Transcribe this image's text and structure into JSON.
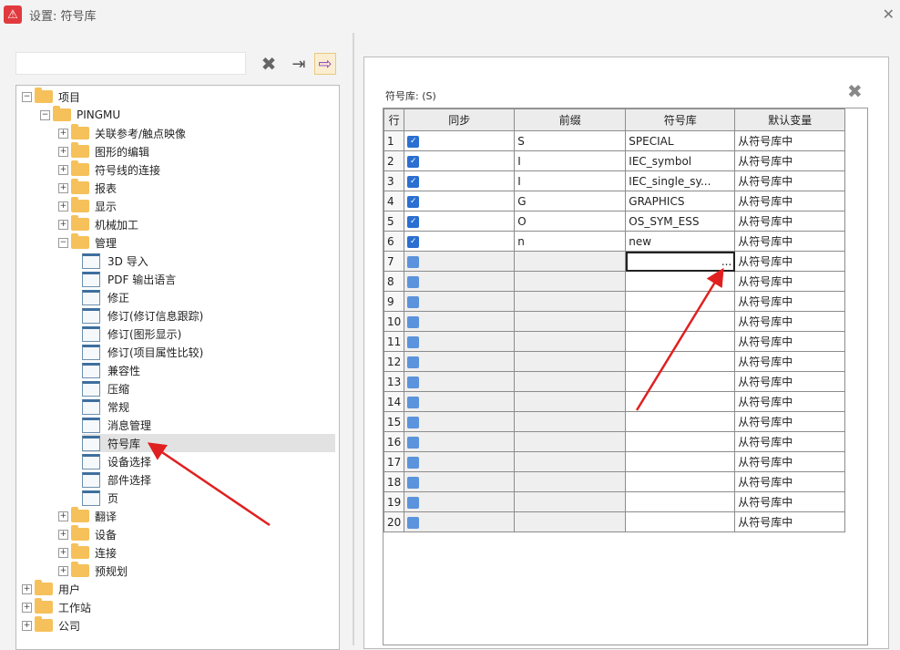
{
  "window": {
    "title": "设置: 符号库",
    "app_icon": "warning-triangle-icon"
  },
  "toolbar": {
    "clear_icon": "close-x-icon",
    "import_icon": "import-icon",
    "export_icon": "export-icon"
  },
  "tree": [
    {
      "label": "项目",
      "level": 0,
      "type": "folder",
      "state": "expanded"
    },
    {
      "label": "PINGMU",
      "level": 1,
      "type": "folder",
      "state": "expanded"
    },
    {
      "label": "关联参考/触点映像",
      "level": 2,
      "type": "folder",
      "state": "collapsed"
    },
    {
      "label": "图形的编辑",
      "level": 2,
      "type": "folder",
      "state": "collapsed"
    },
    {
      "label": "符号线的连接",
      "level": 2,
      "type": "folder",
      "state": "collapsed"
    },
    {
      "label": "报表",
      "level": 2,
      "type": "folder",
      "state": "collapsed"
    },
    {
      "label": "显示",
      "level": 2,
      "type": "folder",
      "state": "collapsed"
    },
    {
      "label": "机械加工",
      "level": 2,
      "type": "folder",
      "state": "collapsed"
    },
    {
      "label": "管理",
      "level": 2,
      "type": "folder",
      "state": "expanded"
    },
    {
      "label": "3D 导入",
      "level": 3,
      "type": "page"
    },
    {
      "label": "PDF 输出语言",
      "level": 3,
      "type": "page"
    },
    {
      "label": "修正",
      "level": 3,
      "type": "page"
    },
    {
      "label": "修订(修订信息跟踪)",
      "level": 3,
      "type": "page"
    },
    {
      "label": "修订(图形显示)",
      "level": 3,
      "type": "page"
    },
    {
      "label": "修订(项目属性比较)",
      "level": 3,
      "type": "page"
    },
    {
      "label": "兼容性",
      "level": 3,
      "type": "page"
    },
    {
      "label": "压缩",
      "level": 3,
      "type": "page"
    },
    {
      "label": "常规",
      "level": 3,
      "type": "page"
    },
    {
      "label": "消息管理",
      "level": 3,
      "type": "page"
    },
    {
      "label": "符号库",
      "level": 3,
      "type": "page",
      "selected": true
    },
    {
      "label": "设备选择",
      "level": 3,
      "type": "page"
    },
    {
      "label": "部件选择",
      "level": 3,
      "type": "page"
    },
    {
      "label": "页",
      "level": 3,
      "type": "page"
    },
    {
      "label": "翻译",
      "level": 2,
      "type": "folder",
      "state": "collapsed"
    },
    {
      "label": "设备",
      "level": 2,
      "type": "folder",
      "state": "collapsed"
    },
    {
      "label": "连接",
      "level": 2,
      "type": "folder",
      "state": "collapsed"
    },
    {
      "label": "预规划",
      "level": 2,
      "type": "folder",
      "state": "collapsed"
    },
    {
      "label": "用户",
      "level": 0,
      "type": "folder",
      "state": "collapsed"
    },
    {
      "label": "工作站",
      "level": 0,
      "type": "folder",
      "state": "collapsed"
    },
    {
      "label": "公司",
      "level": 0,
      "type": "folder",
      "state": "collapsed"
    }
  ],
  "panel": {
    "label": "符号库: (S)",
    "close_icon": "close-x-icon"
  },
  "table": {
    "headers": [
      "行",
      "同步",
      "前缀",
      "符号库",
      "默认变量"
    ],
    "rows": [
      {
        "n": "1",
        "sync": true,
        "prefix": "S",
        "lib": "SPECIAL",
        "def": "从符号库中"
      },
      {
        "n": "2",
        "sync": true,
        "prefix": "I",
        "lib": "IEC_symbol",
        "def": "从符号库中"
      },
      {
        "n": "3",
        "sync": true,
        "prefix": "I",
        "lib": "IEC_single_sy...",
        "def": "从符号库中"
      },
      {
        "n": "4",
        "sync": true,
        "prefix": "G",
        "lib": "GRAPHICS",
        "def": "从符号库中"
      },
      {
        "n": "5",
        "sync": true,
        "prefix": "O",
        "lib": "OS_SYM_ESS",
        "def": "从符号库中"
      },
      {
        "n": "6",
        "sync": true,
        "prefix": "n",
        "lib": "new",
        "def": "从符号库中"
      },
      {
        "n": "7",
        "sync": false,
        "prefix": "",
        "lib": "...",
        "def": "从符号库中",
        "editing": true
      },
      {
        "n": "8",
        "sync": false,
        "prefix": "",
        "lib": "",
        "def": "从符号库中"
      },
      {
        "n": "9",
        "sync": false,
        "prefix": "",
        "lib": "",
        "def": "从符号库中"
      },
      {
        "n": "10",
        "sync": false,
        "prefix": "",
        "lib": "",
        "def": "从符号库中"
      },
      {
        "n": "11",
        "sync": false,
        "prefix": "",
        "lib": "",
        "def": "从符号库中"
      },
      {
        "n": "12",
        "sync": false,
        "prefix": "",
        "lib": "",
        "def": "从符号库中"
      },
      {
        "n": "13",
        "sync": false,
        "prefix": "",
        "lib": "",
        "def": "从符号库中"
      },
      {
        "n": "14",
        "sync": false,
        "prefix": "",
        "lib": "",
        "def": "从符号库中"
      },
      {
        "n": "15",
        "sync": false,
        "prefix": "",
        "lib": "",
        "def": "从符号库中"
      },
      {
        "n": "16",
        "sync": false,
        "prefix": "",
        "lib": "",
        "def": "从符号库中"
      },
      {
        "n": "17",
        "sync": false,
        "prefix": "",
        "lib": "",
        "def": "从符号库中"
      },
      {
        "n": "18",
        "sync": false,
        "prefix": "",
        "lib": "",
        "def": "从符号库中"
      },
      {
        "n": "19",
        "sync": false,
        "prefix": "",
        "lib": "",
        "def": "从符号库中"
      },
      {
        "n": "20",
        "sync": false,
        "prefix": "",
        "lib": "",
        "def": "从符号库中"
      }
    ]
  },
  "colors": {
    "accent": "#2a6fd1",
    "annotation": "#e02020",
    "folder": "#f6c15a"
  }
}
